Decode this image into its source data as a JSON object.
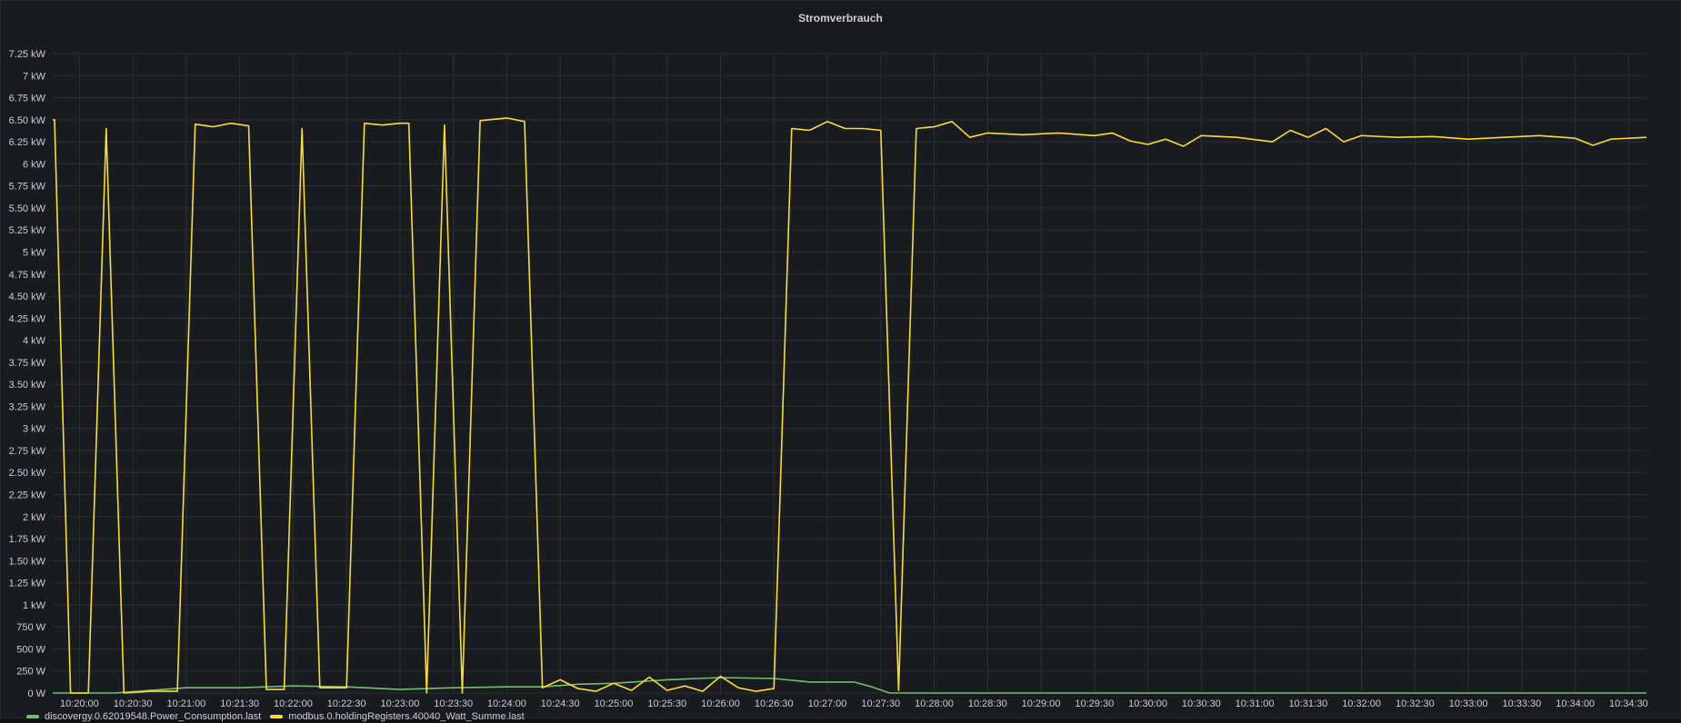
{
  "panel": {
    "title": "Stromverbrauch"
  },
  "colors": {
    "background": "#181b1f",
    "grid": "#2c3036",
    "text": "#ccccdc"
  },
  "chart_data": {
    "type": "line",
    "title": "Stromverbrauch",
    "xlabel": "",
    "ylabel": "",
    "grid": true,
    "legend_position": "bottom-left",
    "y_ticks": [
      {
        "value": 0,
        "label": "0 W"
      },
      {
        "value": 250,
        "label": "250 W"
      },
      {
        "value": 500,
        "label": "500 W"
      },
      {
        "value": 750,
        "label": "750 W"
      },
      {
        "value": 1000,
        "label": "1 kW"
      },
      {
        "value": 1250,
        "label": "1.25 kW"
      },
      {
        "value": 1500,
        "label": "1.50 kW"
      },
      {
        "value": 1750,
        "label": "1.75 kW"
      },
      {
        "value": 2000,
        "label": "2 kW"
      },
      {
        "value": 2250,
        "label": "2.25 kW"
      },
      {
        "value": 2500,
        "label": "2.50 kW"
      },
      {
        "value": 2750,
        "label": "2.75 kW"
      },
      {
        "value": 3000,
        "label": "3 kW"
      },
      {
        "value": 3250,
        "label": "3.25 kW"
      },
      {
        "value": 3500,
        "label": "3.50 kW"
      },
      {
        "value": 3750,
        "label": "3.75 kW"
      },
      {
        "value": 4000,
        "label": "4 kW"
      },
      {
        "value": 4250,
        "label": "4.25 kW"
      },
      {
        "value": 4500,
        "label": "4.50 kW"
      },
      {
        "value": 4750,
        "label": "4.75 kW"
      },
      {
        "value": 5000,
        "label": "5 kW"
      },
      {
        "value": 5250,
        "label": "5.25 kW"
      },
      {
        "value": 5500,
        "label": "5.50 kW"
      },
      {
        "value": 5750,
        "label": "5.75 kW"
      },
      {
        "value": 6000,
        "label": "6 kW"
      },
      {
        "value": 6250,
        "label": "6.25 kW"
      },
      {
        "value": 6500,
        "label": "6.50 kW"
      },
      {
        "value": 6750,
        "label": "6.75 kW"
      },
      {
        "value": 7000,
        "label": "7 kW"
      },
      {
        "value": 7250,
        "label": "7.25 kW"
      }
    ],
    "ylim": [
      0,
      7250
    ],
    "xlim": [
      "10:19:45",
      "10:34:40"
    ],
    "x_ticks": [
      "10:20:00",
      "10:20:30",
      "10:21:00",
      "10:21:30",
      "10:22:00",
      "10:22:30",
      "10:23:00",
      "10:23:30",
      "10:24:00",
      "10:24:30",
      "10:25:00",
      "10:25:30",
      "10:26:00",
      "10:26:30",
      "10:27:00",
      "10:27:30",
      "10:28:00",
      "10:28:30",
      "10:29:00",
      "10:29:30",
      "10:30:00",
      "10:30:30",
      "10:31:00",
      "10:31:30",
      "10:32:00",
      "10:32:30",
      "10:33:00",
      "10:33:30",
      "10:34:00",
      "10:34:30"
    ],
    "series": [
      {
        "name": "discovergy.0.62019548.Power_Consumption.last",
        "color": "#73bf69",
        "points": [
          [
            "10:19:45",
            0
          ],
          [
            "10:20:00",
            0
          ],
          [
            "10:20:20",
            0
          ],
          [
            "10:20:40",
            30
          ],
          [
            "10:21:00",
            60
          ],
          [
            "10:21:30",
            60
          ],
          [
            "10:22:00",
            80
          ],
          [
            "10:22:30",
            70
          ],
          [
            "10:23:00",
            40
          ],
          [
            "10:23:30",
            60
          ],
          [
            "10:24:00",
            70
          ],
          [
            "10:24:20",
            70
          ],
          [
            "10:24:40",
            100
          ],
          [
            "10:25:00",
            110
          ],
          [
            "10:25:30",
            150
          ],
          [
            "10:26:00",
            175
          ],
          [
            "10:26:30",
            165
          ],
          [
            "10:26:50",
            125
          ],
          [
            "10:27:15",
            125
          ],
          [
            "10:27:25",
            70
          ],
          [
            "10:27:35",
            0
          ],
          [
            "10:28:00",
            0
          ],
          [
            "10:30:00",
            0
          ],
          [
            "10:32:00",
            0
          ],
          [
            "10:34:00",
            0
          ],
          [
            "10:34:40",
            0
          ]
        ]
      },
      {
        "name": "modbus.0.holdingRegisters.40040_Watt_Summe.last",
        "color": "#fade2a",
        "points": [
          [
            "10:19:45",
            6500
          ],
          [
            "10:19:46",
            6500
          ],
          [
            "10:19:55",
            0
          ],
          [
            "10:20:05",
            0
          ],
          [
            "10:20:15",
            6400
          ],
          [
            "10:20:25",
            0
          ],
          [
            "10:20:40",
            20
          ],
          [
            "10:20:55",
            20
          ],
          [
            "10:21:05",
            6450
          ],
          [
            "10:21:15",
            6420
          ],
          [
            "10:21:25",
            6460
          ],
          [
            "10:21:35",
            6430
          ],
          [
            "10:21:45",
            40
          ],
          [
            "10:21:55",
            40
          ],
          [
            "10:22:05",
            6400
          ],
          [
            "10:22:15",
            60
          ],
          [
            "10:22:30",
            60
          ],
          [
            "10:22:40",
            6460
          ],
          [
            "10:22:50",
            6440
          ],
          [
            "10:23:00",
            6460
          ],
          [
            "10:23:05",
            6460
          ],
          [
            "10:23:15",
            0
          ],
          [
            "10:23:25",
            6440
          ],
          [
            "10:23:35",
            0
          ],
          [
            "10:23:45",
            6490
          ],
          [
            "10:24:00",
            6520
          ],
          [
            "10:24:10",
            6480
          ],
          [
            "10:24:20",
            60
          ],
          [
            "10:24:30",
            150
          ],
          [
            "10:24:40",
            50
          ],
          [
            "10:24:50",
            20
          ],
          [
            "10:25:00",
            110
          ],
          [
            "10:25:10",
            30
          ],
          [
            "10:25:20",
            180
          ],
          [
            "10:25:30",
            30
          ],
          [
            "10:25:40",
            80
          ],
          [
            "10:25:50",
            20
          ],
          [
            "10:26:00",
            190
          ],
          [
            "10:26:10",
            60
          ],
          [
            "10:26:20",
            20
          ],
          [
            "10:26:30",
            50
          ],
          [
            "10:26:40",
            6400
          ],
          [
            "10:26:50",
            6380
          ],
          [
            "10:27:00",
            6480
          ],
          [
            "10:27:10",
            6400
          ],
          [
            "10:27:20",
            6400
          ],
          [
            "10:27:30",
            6380
          ],
          [
            "10:27:40",
            30
          ],
          [
            "10:27:50",
            6400
          ],
          [
            "10:28:00",
            6420
          ],
          [
            "10:28:10",
            6480
          ],
          [
            "10:28:20",
            6300
          ],
          [
            "10:28:30",
            6350
          ],
          [
            "10:28:50",
            6330
          ],
          [
            "10:29:10",
            6350
          ],
          [
            "10:29:30",
            6320
          ],
          [
            "10:29:40",
            6350
          ],
          [
            "10:29:50",
            6260
          ],
          [
            "10:30:00",
            6220
          ],
          [
            "10:30:10",
            6280
          ],
          [
            "10:30:20",
            6200
          ],
          [
            "10:30:30",
            6320
          ],
          [
            "10:30:50",
            6300
          ],
          [
            "10:31:10",
            6250
          ],
          [
            "10:31:20",
            6380
          ],
          [
            "10:31:30",
            6300
          ],
          [
            "10:31:40",
            6400
          ],
          [
            "10:31:50",
            6250
          ],
          [
            "10:32:00",
            6320
          ],
          [
            "10:32:20",
            6300
          ],
          [
            "10:32:40",
            6310
          ],
          [
            "10:33:00",
            6280
          ],
          [
            "10:33:20",
            6300
          ],
          [
            "10:33:40",
            6320
          ],
          [
            "10:34:00",
            6290
          ],
          [
            "10:34:10",
            6210
          ],
          [
            "10:34:20",
            6280
          ],
          [
            "10:34:40",
            6300
          ]
        ]
      }
    ]
  },
  "legend": {
    "items": [
      {
        "label": "discovergy.0.62019548.Power_Consumption.last",
        "color": "#73bf69"
      },
      {
        "label": "modbus.0.holdingRegisters.40040_Watt_Summe.last",
        "color": "#fade2a"
      }
    ]
  }
}
